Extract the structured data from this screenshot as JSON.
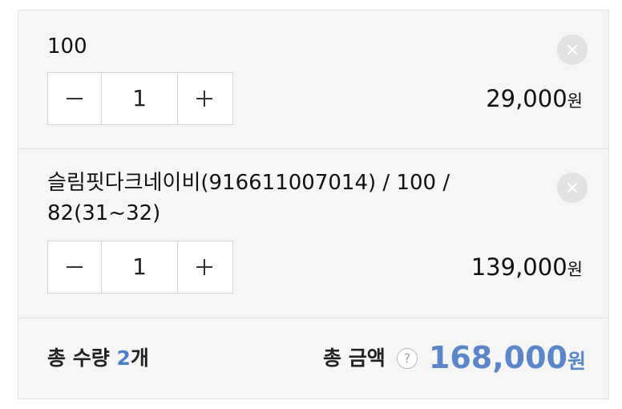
{
  "cart": {
    "items": [
      {
        "name": "100",
        "quantity": "1",
        "price": "29,000",
        "currency": "원",
        "decrease_symbol": "−",
        "increase_symbol": "+"
      },
      {
        "name": "슬림핏다크네이비(916611007014) / 100 /\n82(31~32)",
        "quantity": "1",
        "price": "139,000",
        "currency": "원",
        "decrease_symbol": "−",
        "increase_symbol": "+"
      }
    ],
    "summary": {
      "total_quantity_label": "총 수량",
      "total_quantity_value": "2",
      "total_quantity_unit": "개",
      "total_amount_label": "총 금액",
      "help_symbol": "?",
      "total_amount_value": "168,000",
      "total_amount_unit": "원"
    }
  },
  "colors": {
    "accent": "#5b86c9",
    "border": "#e3e3e3",
    "background": "#f6f6f6",
    "remove_button": "#e2e2e2"
  },
  "icons": {
    "remove": "close-icon",
    "decrease": "minus-icon",
    "increase": "plus-icon",
    "help": "question-icon"
  }
}
